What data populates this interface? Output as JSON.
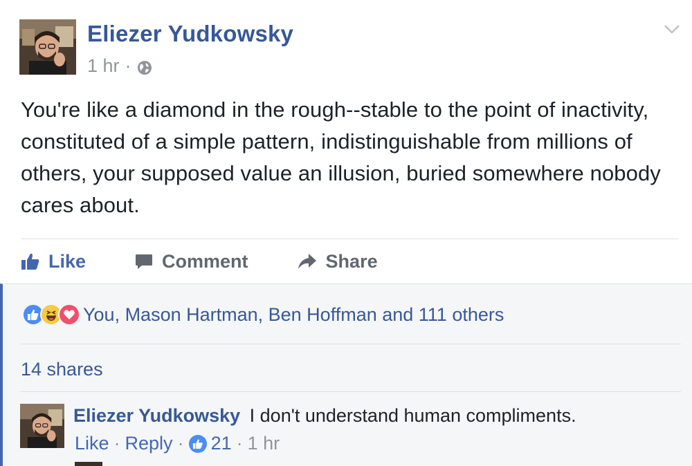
{
  "post": {
    "author": "Eliezer Yudkowsky",
    "timestamp": "1 hr",
    "separator": "·",
    "privacy_icon": "globe-icon",
    "text": "You're like a diamond in the rough--stable to the point of inactivity, constituted of a simple pattern, indistinguishable from millions of others, your supposed value an illusion, buried somewhere nobody cares about."
  },
  "actions": {
    "like_label": "Like",
    "comment_label": "Comment",
    "share_label": "Share"
  },
  "feedback": {
    "reaction_icons": [
      "like",
      "haha",
      "love"
    ],
    "reactors_text": "You, Mason Hartman, Ben Hoffman and 111 others",
    "shares_text": "14 shares"
  },
  "comment": {
    "author": "Eliezer Yudkowsky",
    "text": "I don't understand human compliments.",
    "like_label": "Like",
    "reply_label": "Reply",
    "like_count": "21",
    "timestamp": "1 hr",
    "separator": "·"
  },
  "colors": {
    "link_blue": "#365899",
    "accent_blue": "#4267b2",
    "muted_gray": "#90949c",
    "feedback_bg": "#f5f6f7"
  }
}
